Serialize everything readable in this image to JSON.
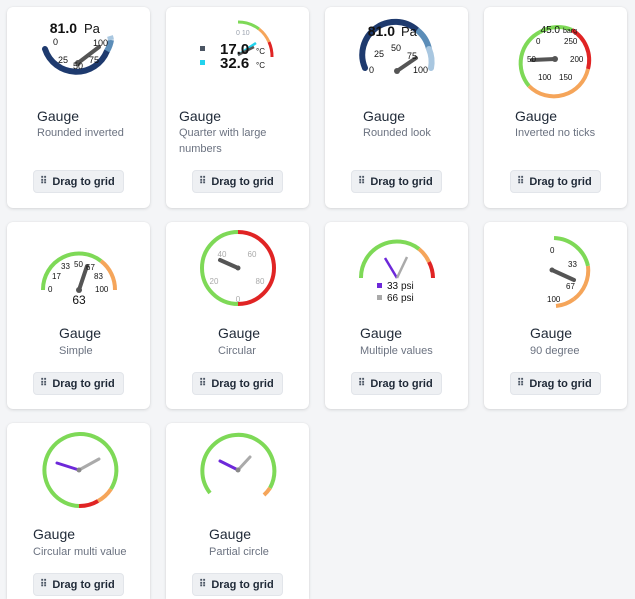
{
  "common": {
    "drag_label": "Drag to grid",
    "grip_glyph": "⠿"
  },
  "cards": [
    {
      "title": "Gauge",
      "subtitle": "Rounded inverted",
      "value": "81.0",
      "unit": "Pa",
      "ticks": [
        "0",
        "25",
        "50",
        "75",
        "100"
      ]
    },
    {
      "title": "Gauge",
      "subtitle": "Quarter with large numbers",
      "values": [
        "17.0",
        "32.6"
      ],
      "unit": "°C",
      "colors": [
        "#4b5563",
        "#22d3ee"
      ]
    },
    {
      "title": "Gauge",
      "subtitle": "Rounded look",
      "value": "81.0",
      "unit": "Pa",
      "ticks": [
        "0",
        "25",
        "50",
        "75",
        "100"
      ]
    },
    {
      "title": "Gauge",
      "subtitle": "Inverted no ticks",
      "value": "45.0",
      "unit": "barg",
      "ticks": [
        "0",
        "50",
        "100",
        "150",
        "200",
        "250"
      ]
    },
    {
      "title": "Gauge",
      "subtitle": "Simple",
      "value": "63",
      "ticks": [
        "0",
        "17",
        "33",
        "50",
        "67",
        "83",
        "100"
      ]
    },
    {
      "title": "Gauge",
      "subtitle": "Circular",
      "ticks": [
        "0",
        "20",
        "40",
        "60",
        "80"
      ]
    },
    {
      "title": "Gauge",
      "subtitle": "Multiple values",
      "values": [
        "33",
        "66"
      ],
      "unit": "psi",
      "colors": [
        "#6d28d9",
        "#aaaaaa"
      ]
    },
    {
      "title": "Gauge",
      "subtitle": "90 degree",
      "ticks": [
        "0",
        "33",
        "67",
        "100"
      ]
    },
    {
      "title": "Gauge",
      "subtitle": "Circular multi value"
    },
    {
      "title": "Gauge",
      "subtitle": "Partial circle"
    }
  ],
  "palette": {
    "green": "#7ed957",
    "orange": "#f5a55a",
    "red": "#e02424",
    "navy": "#1e3a6e",
    "steel": "#5b8db8",
    "needle": "#555555",
    "purple": "#6d28d9",
    "gray_needle": "#aaaaaa"
  }
}
